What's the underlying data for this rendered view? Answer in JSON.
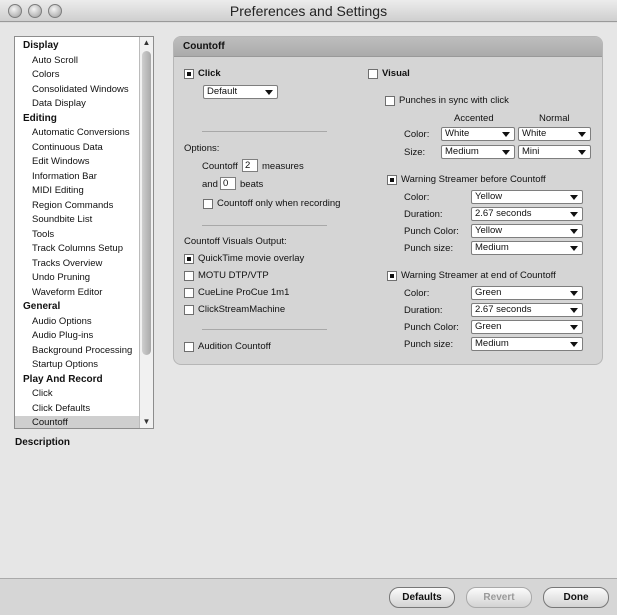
{
  "window": {
    "title": "Preferences and Settings"
  },
  "sidebar": {
    "groups": [
      {
        "label": "Display",
        "items": [
          "Auto Scroll",
          "Colors",
          "Consolidated Windows",
          "Data Display"
        ]
      },
      {
        "label": "Editing",
        "items": [
          "Automatic Conversions",
          "Continuous Data",
          "Edit Windows",
          "Information Bar",
          "MIDI Editing",
          "Region Commands",
          "Soundbite List",
          "Tools",
          "Track Columns Setup",
          "Tracks Overview",
          "Undo Pruning",
          "Waveform Editor"
        ]
      },
      {
        "label": "General",
        "items": [
          "Audio Options",
          "Audio Plug-ins",
          "Background Processing",
          "Startup Options"
        ]
      },
      {
        "label": "Play And Record",
        "items": [
          "Click",
          "Click Defaults",
          "Countoff"
        ]
      }
    ],
    "selected": "Countoff"
  },
  "description_label": "Description",
  "panel": {
    "title": "Countoff",
    "click": {
      "label": "Click",
      "checked": true,
      "preset": "Default"
    },
    "options": {
      "label": "Options:",
      "countoff_label": "Countoff",
      "countoff_value": "2",
      "measures_label": "measures",
      "and_label": "and",
      "beats_value": "0",
      "beats_label": "beats",
      "only_recording_label": "Countoff only when recording",
      "only_recording_checked": false
    },
    "visuals_output": {
      "label": "Countoff Visuals Output:",
      "items": [
        {
          "label": "QuickTime movie overlay",
          "checked": true
        },
        {
          "label": "MOTU DTP/VTP",
          "checked": false
        },
        {
          "label": "CueLine ProCue 1m1",
          "checked": false
        },
        {
          "label": "ClickStreamMachine",
          "checked": false
        }
      ]
    },
    "audition": {
      "label": "Audition Countoff",
      "checked": false
    },
    "visual": {
      "label": "Visual",
      "checked": false,
      "punches_sync_label": "Punches in sync with click",
      "punches_sync_checked": false,
      "accented_label": "Accented",
      "normal_label": "Normal",
      "color_label": "Color:",
      "size_label": "Size:",
      "accented_color": "White",
      "normal_color": "White",
      "accented_size": "Medium",
      "normal_size": "Mini"
    },
    "streamer_before": {
      "label": "Warning Streamer before Countoff",
      "checked": true,
      "color_label": "Color:",
      "color": "Yellow",
      "duration_label": "Duration:",
      "duration": "2.67 seconds",
      "punch_color_label": "Punch Color:",
      "punch_color": "Yellow",
      "punch_size_label": "Punch size:",
      "punch_size": "Medium"
    },
    "streamer_end": {
      "label": "Warning Streamer at end of Countoff",
      "checked": true,
      "color_label": "Color:",
      "color": "Green",
      "duration_label": "Duration:",
      "duration": "2.67 seconds",
      "punch_color_label": "Punch Color:",
      "punch_color": "Green",
      "punch_size_label": "Punch size:",
      "punch_size": "Medium"
    }
  },
  "buttons": {
    "defaults": "Defaults",
    "revert": "Revert",
    "done": "Done"
  }
}
